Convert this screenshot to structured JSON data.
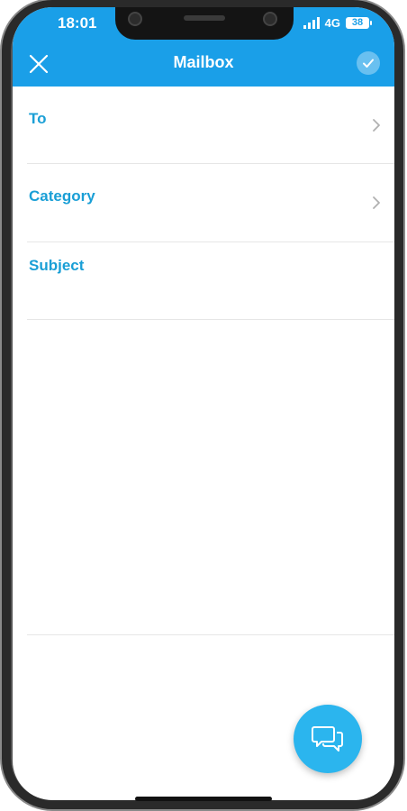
{
  "status_bar": {
    "time": "18:01",
    "network": "4G",
    "battery": "38"
  },
  "header": {
    "title": "Mailbox",
    "close_icon": "close-x-icon",
    "send_icon": "check-circle-icon"
  },
  "form": {
    "to_label": "To",
    "category_label": "Category",
    "subject_label": "Subject",
    "chevron_icon": "chevron-right-icon"
  },
  "fab": {
    "icon": "chat-bubbles-icon"
  },
  "colors": {
    "header_background": "#1a9fe8",
    "label_color": "#1a9fd6",
    "fab_background": "#2bb5ee",
    "divider": "#e6e6e6"
  }
}
